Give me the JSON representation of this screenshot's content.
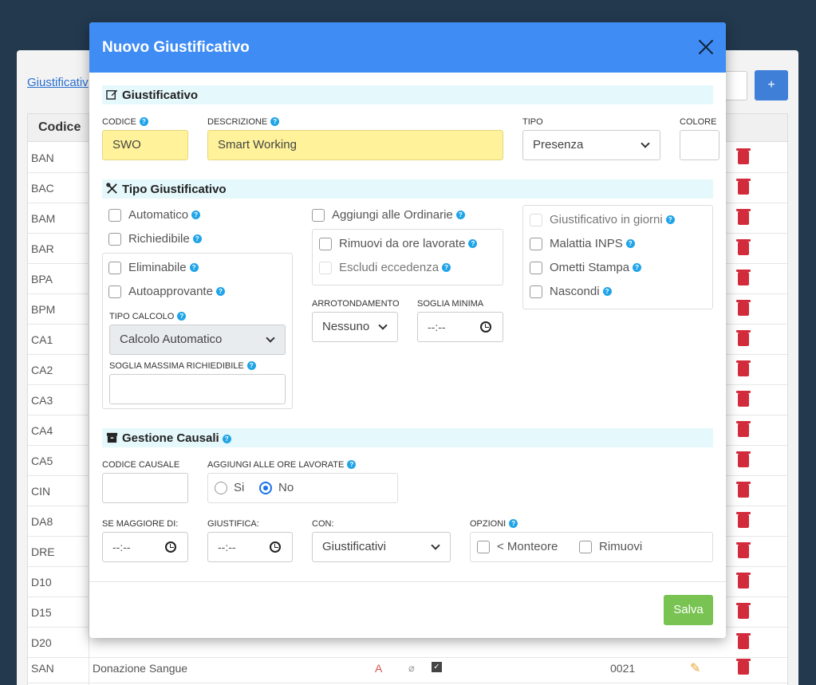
{
  "background": {
    "breadcrumb": "Giustificativ",
    "add_label": "+",
    "column_code": "Codice",
    "rows": [
      {
        "code": "BAN"
      },
      {
        "code": "BAC"
      },
      {
        "code": "BAM"
      },
      {
        "code": "BAR"
      },
      {
        "code": "BPA"
      },
      {
        "code": "BPM"
      },
      {
        "code": "CA1"
      },
      {
        "code": "CA2"
      },
      {
        "code": "CA3"
      },
      {
        "code": "CA4"
      },
      {
        "code": "CA5"
      },
      {
        "code": "CIN"
      },
      {
        "code": "DA8"
      },
      {
        "code": "DRE"
      },
      {
        "code": "D10"
      },
      {
        "code": "D15"
      },
      {
        "code": "D20"
      }
    ],
    "last_row": {
      "code": "SAN",
      "description": "Donazione Sangue",
      "type": "A",
      "number": "0021"
    }
  },
  "modal": {
    "title": "Nuovo Giustificativo",
    "section1": {
      "title": "Giustificativo",
      "codice_label": "CODICE",
      "codice_value": "SWO",
      "descrizione_label": "DESCRIZIONE",
      "descrizione_value": "Smart Working",
      "tipo_label": "TIPO",
      "tipo_value": "Presenza",
      "colore_label": "COLORE"
    },
    "section2": {
      "title": "Tipo Giustificativo",
      "automatico": "Automatico",
      "richiedibile": "Richiedibile",
      "eliminabile": "Eliminabile",
      "autoapprovante": "Autoapprovante",
      "tipo_calcolo_label": "TIPO CALCOLO",
      "tipo_calcolo_value": "Calcolo Automatico",
      "soglia_massima_label": "SOGLIA MASSIMA RICHIEDIBILE",
      "aggiungi_ordinarie": "Aggiungi alle Ordinarie",
      "rimuovi_ore": "Rimuovi da ore lavorate",
      "escludi_eccedenza": "Escludi eccedenza",
      "arrotondamento_label": "ARROTONDAMENTO",
      "arrotondamento_value": "Nessuno",
      "soglia_minima_label": "SOGLIA MINIMA",
      "soglia_minima_value": "--:--",
      "giorni": "Giustificativo in giorni",
      "malattia": "Malattia INPS",
      "ometti_stampa": "Ometti Stampa",
      "nascondi": "Nascondi"
    },
    "section3": {
      "title": "Gestione Causali",
      "codice_causale_label": "CODICE CAUSALE",
      "aggiungi_ore_label": "AGGIUNGI ALLE ORE LAVORATE",
      "si_label": "Si",
      "no_label": "No",
      "maggiore_label": "SE MAGGIORE DI:",
      "maggiore_value": "--:--",
      "giustifica_label": "GIUSTIFICA:",
      "giustifica_value": "--:--",
      "con_label": "CON:",
      "con_value": "Giustificativi",
      "opzioni_label": "OPZIONI",
      "monteore": "< Monteore",
      "rimuovi": "Rimuovi"
    },
    "save_label": "Salva"
  }
}
